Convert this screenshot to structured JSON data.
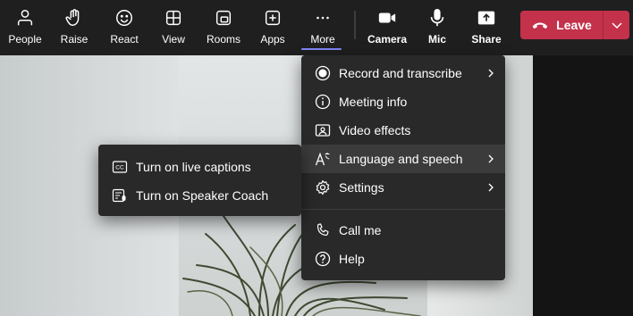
{
  "toolbar": {
    "buttons": [
      {
        "label": "People",
        "icon": "people-icon"
      },
      {
        "label": "Raise",
        "icon": "raise-hand-icon"
      },
      {
        "label": "React",
        "icon": "smiley-icon"
      },
      {
        "label": "View",
        "icon": "grid-view-icon"
      },
      {
        "label": "Rooms",
        "icon": "rooms-icon"
      },
      {
        "label": "Apps",
        "icon": "plus-square-icon"
      },
      {
        "label": "More",
        "icon": "ellipsis-icon"
      },
      {
        "label": "Camera",
        "icon": "camera-icon"
      },
      {
        "label": "Mic",
        "icon": "mic-icon"
      },
      {
        "label": "Share",
        "icon": "share-icon"
      }
    ],
    "leave_label": "Leave"
  },
  "more_menu": {
    "items": [
      {
        "label": "Record and transcribe",
        "icon": "record-icon",
        "submenu": true
      },
      {
        "label": "Meeting info",
        "icon": "info-icon",
        "submenu": false
      },
      {
        "label": "Video effects",
        "icon": "video-effects-icon",
        "submenu": false
      },
      {
        "label": "Language and speech",
        "icon": "language-icon",
        "submenu": true,
        "highlighted": true
      },
      {
        "label": "Settings",
        "icon": "gear-icon",
        "submenu": true
      }
    ],
    "items_after_divider": [
      {
        "label": "Call me",
        "icon": "phone-icon"
      },
      {
        "label": "Help",
        "icon": "help-icon"
      }
    ]
  },
  "language_submenu": {
    "items": [
      {
        "label": "Turn on live captions",
        "icon": "cc-icon"
      },
      {
        "label": "Turn on Speaker Coach",
        "icon": "speaker-coach-icon"
      }
    ]
  },
  "colors": {
    "background": "#1f1f1f",
    "menu": "#292929",
    "highlight": "#3b3b3b",
    "leave": "#c4314b",
    "accent": "#7f85f5"
  }
}
